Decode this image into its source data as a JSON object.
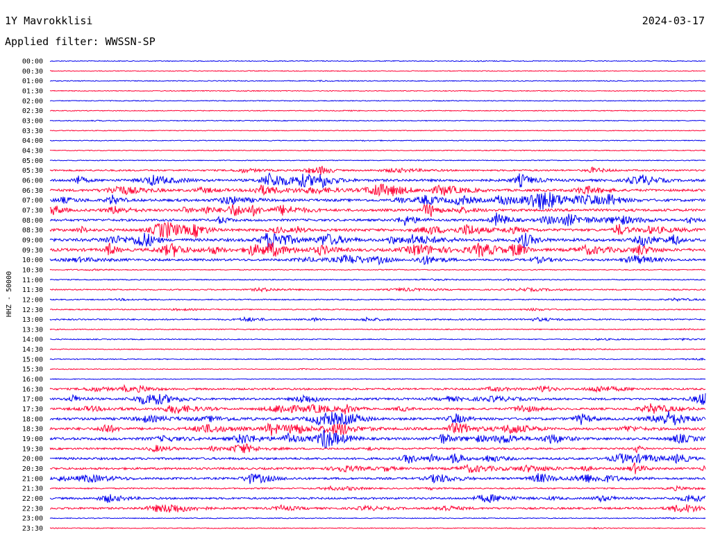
{
  "header": {
    "station": "1Y Mavrokklisi",
    "date": "2024-03-17",
    "filter": "Applied filter: WWSSN-SP"
  },
  "chart_data": {
    "type": "line",
    "ylabel": "HHZ - 50000",
    "colors": [
      "#0000ee",
      "#ff0033"
    ],
    "rows": [
      {
        "label": "00:00",
        "activity": 0.05
      },
      {
        "label": "00:30",
        "activity": 0.03
      },
      {
        "label": "01:00",
        "activity": 0.06
      },
      {
        "label": "01:30",
        "activity": 0.05
      },
      {
        "label": "02:00",
        "activity": 0.04
      },
      {
        "label": "02:30",
        "activity": 0.04
      },
      {
        "label": "03:00",
        "activity": 0.05
      },
      {
        "label": "03:30",
        "activity": 0.03
      },
      {
        "label": "04:00",
        "activity": 0.04
      },
      {
        "label": "04:30",
        "activity": 0.04
      },
      {
        "label": "05:00",
        "activity": 0.05
      },
      {
        "label": "05:30",
        "activity": 0.35
      },
      {
        "label": "06:00",
        "activity": 0.7
      },
      {
        "label": "06:30",
        "activity": 0.65
      },
      {
        "label": "07:00",
        "activity": 0.75
      },
      {
        "label": "07:30",
        "activity": 0.7
      },
      {
        "label": "08:00",
        "activity": 0.6
      },
      {
        "label": "08:30",
        "activity": 0.75
      },
      {
        "label": "09:00",
        "activity": 0.85
      },
      {
        "label": "09:30",
        "activity": 0.85
      },
      {
        "label": "10:00",
        "activity": 0.6
      },
      {
        "label": "10:30",
        "activity": 0.1
      },
      {
        "label": "11:00",
        "activity": 0.12
      },
      {
        "label": "11:30",
        "activity": 0.2
      },
      {
        "label": "12:00",
        "activity": 0.15
      },
      {
        "label": "12:30",
        "activity": 0.15
      },
      {
        "label": "13:00",
        "activity": 0.3
      },
      {
        "label": "13:30",
        "activity": 0.1
      },
      {
        "label": "14:00",
        "activity": 0.12
      },
      {
        "label": "14:30",
        "activity": 0.08
      },
      {
        "label": "15:00",
        "activity": 0.1
      },
      {
        "label": "15:30",
        "activity": 0.04
      },
      {
        "label": "16:00",
        "activity": 0.06
      },
      {
        "label": "16:30",
        "activity": 0.45
      },
      {
        "label": "17:00",
        "activity": 0.55
      },
      {
        "label": "17:30",
        "activity": 0.55
      },
      {
        "label": "18:00",
        "activity": 0.7
      },
      {
        "label": "18:30",
        "activity": 0.75
      },
      {
        "label": "19:00",
        "activity": 0.7
      },
      {
        "label": "19:30",
        "activity": 0.45
      },
      {
        "label": "20:00",
        "activity": 0.6
      },
      {
        "label": "20:30",
        "activity": 0.55
      },
      {
        "label": "21:00",
        "activity": 0.55
      },
      {
        "label": "21:30",
        "activity": 0.25
      },
      {
        "label": "22:00",
        "activity": 0.5
      },
      {
        "label": "22:30",
        "activity": 0.5
      },
      {
        "label": "23:00",
        "activity": 0.06
      },
      {
        "label": "23:30",
        "activity": 0.05
      }
    ]
  }
}
